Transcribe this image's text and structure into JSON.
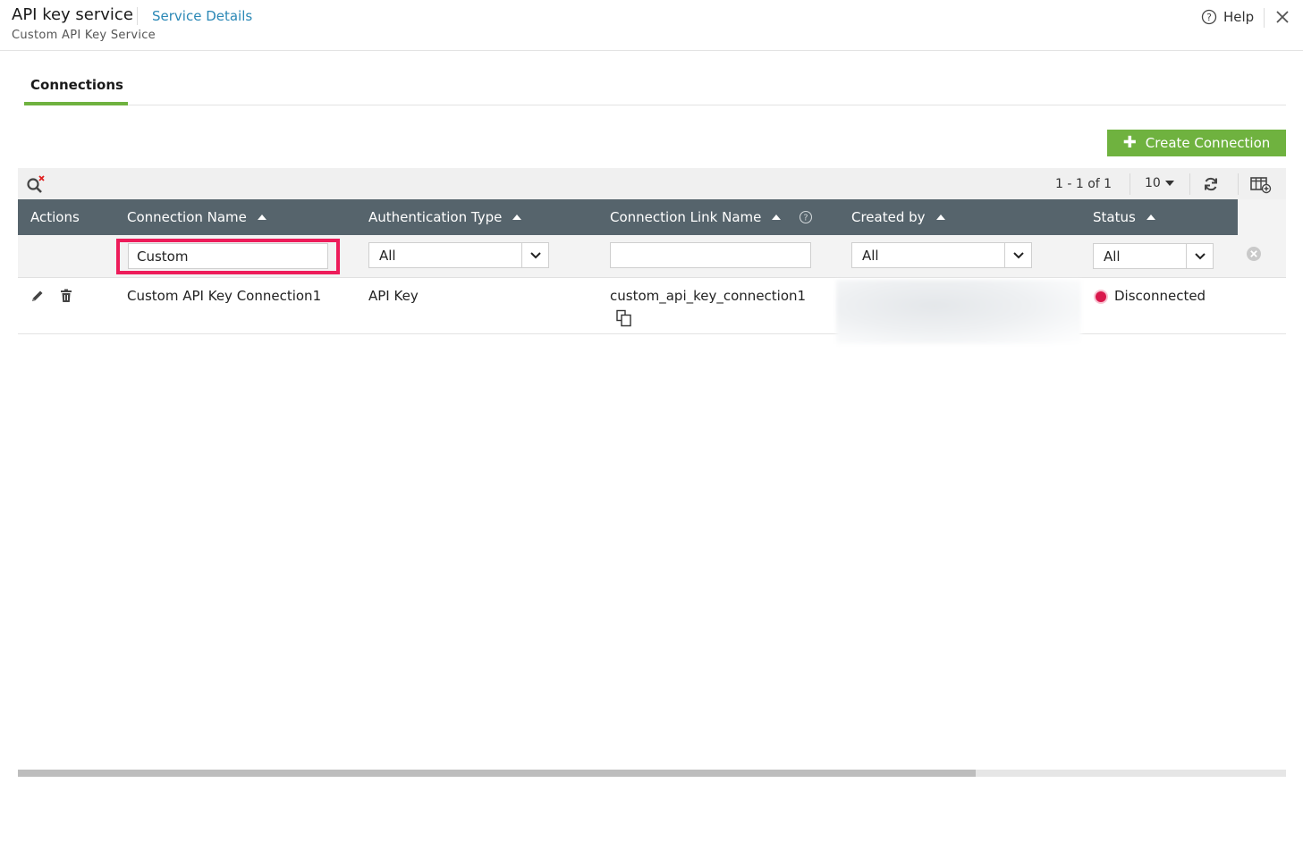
{
  "header": {
    "title": "API key service",
    "service_link": "Service Details",
    "subtitle": "Custom API Key Service",
    "help_label": "Help"
  },
  "tabs": [
    {
      "label": "Connections",
      "active": true
    }
  ],
  "create_button": {
    "label": "Create Connection"
  },
  "toolbar": {
    "pager": "1 - 1 of 1",
    "page_size": "10"
  },
  "table": {
    "columns": [
      {
        "label": "Actions"
      },
      {
        "label": "Connection Name"
      },
      {
        "label": "Authentication Type"
      },
      {
        "label": "Connection Link Name"
      },
      {
        "label": "Created by"
      },
      {
        "label": "Status"
      }
    ],
    "filters": {
      "connection_name": "Custom",
      "auth_type": "All",
      "link_name": "",
      "created_by": "All",
      "status": "All"
    },
    "rows": [
      {
        "connection_name": "Custom API Key Connection1",
        "auth_type": "API Key",
        "link_name": "custom_api_key_connection1",
        "status": "Disconnected"
      }
    ]
  },
  "colors": {
    "accent_green": "#6fb23f",
    "header_bg": "#56646c",
    "link_blue": "#2b88b6",
    "highlight_red": "#ed1c5a",
    "status_disconnected": "#d9184c"
  },
  "icons": [
    "help-icon",
    "close-icon",
    "search-clear-icon",
    "refresh-icon",
    "column-settings-icon",
    "edit-icon",
    "delete-icon",
    "copy-icon",
    "clear-filter-icon",
    "chevron-down-icon",
    "sort-asc-icon",
    "plus-icon"
  ]
}
